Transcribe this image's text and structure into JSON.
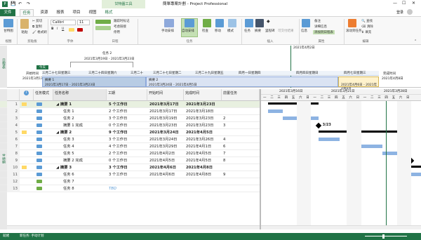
{
  "app": {
    "title": "簡單專案計劃 - Project Professional",
    "contextual_tab": "甘特圖工具",
    "user": "登录"
  },
  "tabs": [
    "文件",
    "任务",
    "资源",
    "报表",
    "项目",
    "视图",
    "格式"
  ],
  "ribbon": {
    "groups": [
      "视图",
      "剪贴板",
      "字体",
      "日程",
      "任务",
      "插入",
      "属性",
      "编辑"
    ],
    "gantt_button": "甘特图",
    "paste": "粘贴",
    "cut": "剪切",
    "copy": "复制",
    "format_painter": "格式刷",
    "font_name": "Calibri",
    "font_size": "11",
    "mark_on_track": "跟踪时标记",
    "respect_links": "考虑链接",
    "inactivate": "停用",
    "manual_schedule": "手动安排",
    "auto_schedule": "自动安排",
    "inspect": "检查",
    "move": "移动",
    "mode": "模式",
    "task": "任务",
    "summary": "摘要",
    "milestone": "里程碑",
    "deliverable": "可交付结果",
    "information": "信息",
    "notes": "备注",
    "details": "详细信息",
    "add_to_timeline": "添加到日程表",
    "scroll_to_task": "滚动到任务",
    "find": "查找",
    "clear": "清除",
    "fill": "填充"
  },
  "timeline": {
    "side_label": "日程表",
    "today_marker": "2021年4月2日",
    "today_flag": "今天",
    "task2_label": "任务 2",
    "task2_dates": "2021年3月19日 - 2021年3月23日",
    "start_label": "开始时间",
    "start_date": "2021年3月17日",
    "finish_label": "完成时间",
    "finish_date": "2021年4月8日",
    "scale": [
      "三月二十七日星期三",
      "三月二十四日星期六",
      "三月二十",
      "三月二十七日星期二",
      "三月二十九日星期五",
      "四月一日星期四",
      "四月四日星期日",
      "四月七日星期三"
    ],
    "bar1_label": "摘要 1",
    "bar1_dates": "2021年3月17日 - 2021年3月23日",
    "bar2_label": "摘要 2",
    "bar2_dates": "2021年3月24日 - 2021年4月5日",
    "bar3_dates": "2021年4月6日 - 2021年4月8日"
  },
  "grid": {
    "side_label": "甘特图",
    "headers": {
      "mode": "任务模式",
      "name": "任务名称",
      "duration": "工期",
      "start": "开始时间",
      "finish": "完成时间",
      "predecessors": "前置任务"
    },
    "rows": [
      {
        "id": "1",
        "name": "摘要 1",
        "duration": "5 个工作日",
        "start": "2021年3月17日",
        "finish": "2021年3月23日",
        "pred": "",
        "summary": true
      },
      {
        "id": "2",
        "name": "任务 1",
        "duration": "2 个工作日",
        "start": "2021年3月17日",
        "finish": "2021年3月18日",
        "pred": "",
        "summary": false
      },
      {
        "id": "3",
        "name": "任务 2",
        "duration": "3 个工作日",
        "start": "2021年3月19日",
        "finish": "2021年3月23日",
        "pred": "2",
        "summary": false
      },
      {
        "id": "4",
        "name": "摘要 1 完成",
        "duration": "0 个工作日",
        "start": "2021年3月23日",
        "finish": "2021年3月23日",
        "pred": "3",
        "summary": false
      },
      {
        "id": "5",
        "name": "摘要 2",
        "duration": "9 个工作日",
        "start": "2021年3月24日",
        "finish": "2021年4月5日",
        "pred": "",
        "summary": true
      },
      {
        "id": "6",
        "name": "任务 3",
        "duration": "3 个工作日",
        "start": "2021年3月24日",
        "finish": "2021年3月26日",
        "pred": "4",
        "summary": false
      },
      {
        "id": "7",
        "name": "任务 4",
        "duration": "4 个工作日",
        "start": "2021年3月29日",
        "finish": "2021年4月1日",
        "pred": "6",
        "summary": false
      },
      {
        "id": "8",
        "name": "任务 5",
        "duration": "2 个工作日",
        "start": "2021年4月2日",
        "finish": "2021年4月5日",
        "pred": "7",
        "summary": false
      },
      {
        "id": "9",
        "name": "摘要 2 完成",
        "duration": "0 个工作日",
        "start": "2021年4月5日",
        "finish": "2021年4月5日",
        "pred": "8",
        "summary": false
      },
      {
        "id": "10",
        "name": "摘要 3",
        "duration": "3 个工作日",
        "start": "2021年4月6日",
        "finish": "2021年4月8日",
        "pred": "",
        "summary": true
      },
      {
        "id": "11",
        "name": "任务 6",
        "duration": "3 个工作日",
        "start": "2021年4月6日",
        "finish": "2021年4月8日",
        "pred": "9",
        "summary": false
      },
      {
        "id": "12",
        "name": "任务 7",
        "duration": "",
        "start": "",
        "finish": "",
        "pred": "",
        "summary": false
      },
      {
        "id": "13",
        "name": "任务 8",
        "duration": "TBD",
        "start": "",
        "finish": "",
        "pred": "",
        "summary": false
      }
    ]
  },
  "gantt": {
    "weeks": [
      "2021年3月16日",
      "2021年3月21日",
      "2021年3月28日"
    ],
    "days": [
      "一",
      "二",
      "三",
      "四",
      "五",
      "六",
      "日",
      "一",
      "二",
      "三",
      "四",
      "五",
      "六",
      "日",
      "一",
      "二",
      "三",
      "四",
      "五",
      "六",
      "日"
    ],
    "milestone_label": "3/23"
  },
  "status": {
    "ready": "就绪",
    "new_tasks": "新任务: 手动计划"
  },
  "colors": {
    "accent": "#217346",
    "bar": "#8db3e2",
    "summary": "#000000",
    "timeline_bar": "#b8cce4"
  }
}
